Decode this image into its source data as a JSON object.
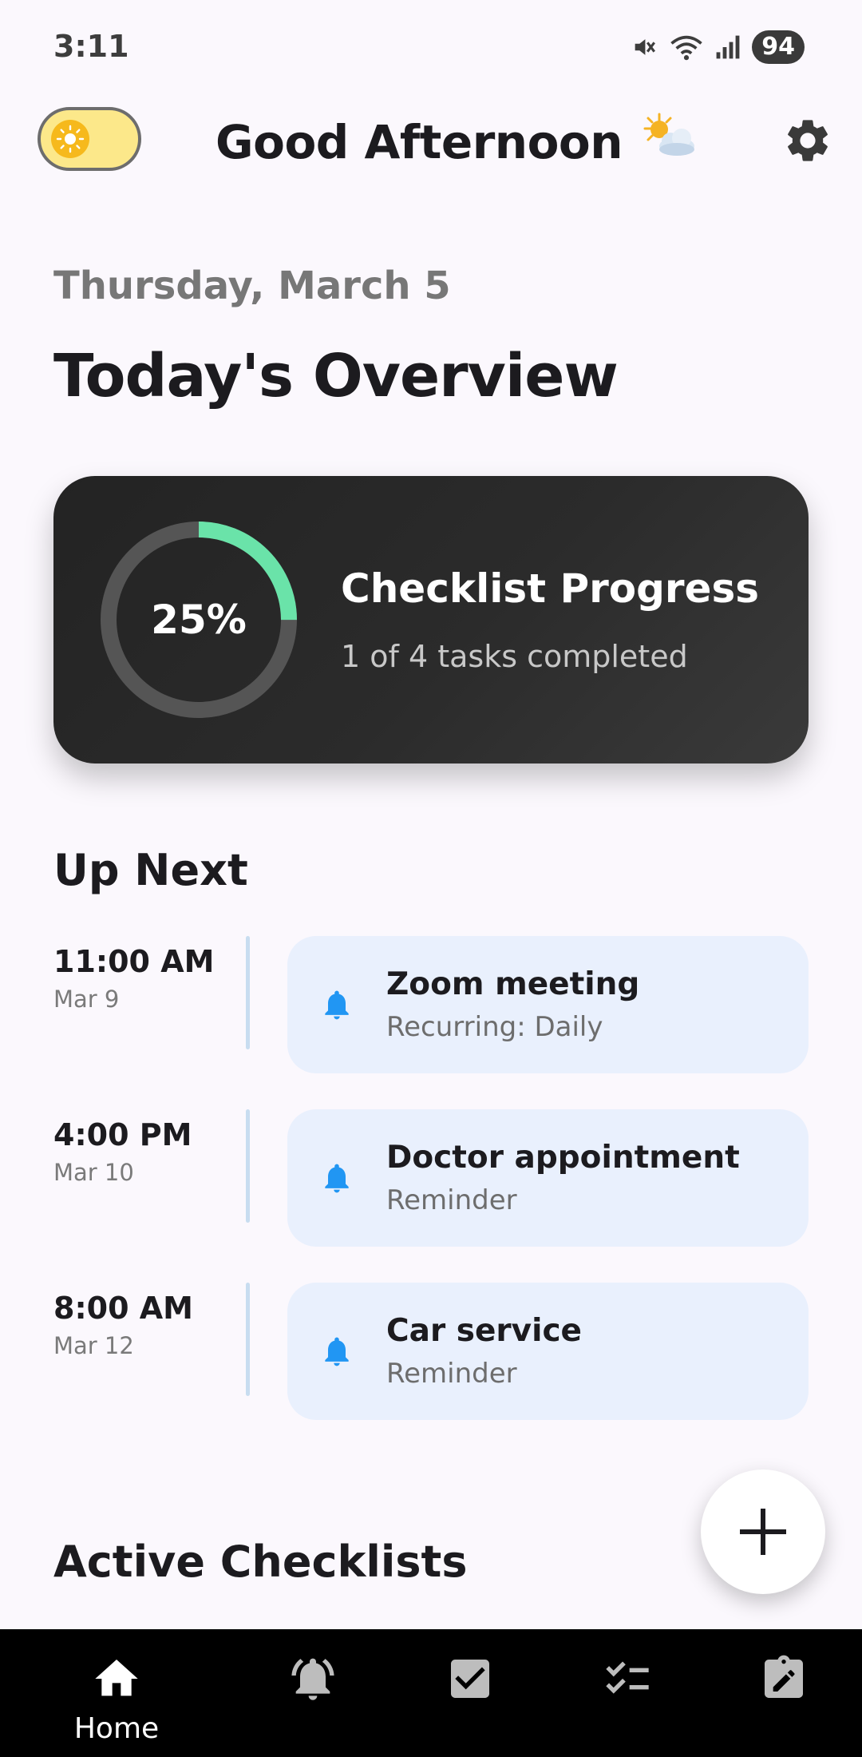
{
  "status_bar": {
    "time": "3:11",
    "battery": "94"
  },
  "header": {
    "greeting": "Good Afternoon",
    "greeting_emoji": "🌤️"
  },
  "date_label": "Thursday, March 5",
  "page_title": "Today's Overview",
  "progress_card": {
    "percent_label": "25%",
    "percent_value": 0.25,
    "title": "Checklist Progress",
    "subtitle": "1 of 4 tasks completed"
  },
  "up_next": {
    "title": "Up Next",
    "items": [
      {
        "time": "11:00 AM",
        "date": "Mar 9",
        "title": "Zoom meeting",
        "subtitle": "Recurring: Daily",
        "icon": "bell-icon"
      },
      {
        "time": "4:00 PM",
        "date": "Mar 10",
        "title": "Doctor appointment",
        "subtitle": "Reminder",
        "icon": "bell-icon"
      },
      {
        "time": "8:00 AM",
        "date": "Mar 12",
        "title": "Car service",
        "subtitle": "Reminder",
        "icon": "bell-icon"
      }
    ]
  },
  "active_checklists": {
    "title": "Active Checklists"
  },
  "bottom_nav": {
    "items": [
      {
        "label": "Home",
        "icon": "home-icon",
        "active": true
      },
      {
        "label": "",
        "icon": "bell-ring-icon",
        "active": false
      },
      {
        "label": "",
        "icon": "checkbox-icon",
        "active": false
      },
      {
        "label": "",
        "icon": "checklist-icon",
        "active": false
      },
      {
        "label": "",
        "icon": "note-edit-icon",
        "active": false
      }
    ]
  },
  "colors": {
    "background": "#fbf8fd",
    "card_dark": "#2b2b2b",
    "progress_accent": "#6ae3a9",
    "ring_track": "#555555",
    "reminder_card": "#e9f0fd",
    "bell": "#2196f3",
    "toggle_bg": "#fce88a",
    "toggle_knob": "#f6b91c"
  }
}
